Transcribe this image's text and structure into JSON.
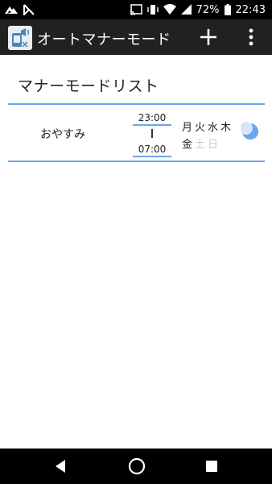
{
  "status_bar": {
    "battery_percent": "72%",
    "time": "22:43"
  },
  "app_bar": {
    "title": "オートマナーモード",
    "icons": [
      "app-logo-icon",
      "add-icon",
      "more-vert-icon"
    ]
  },
  "list": {
    "heading": "マナーモードリスト",
    "items": [
      {
        "name": "おやすみ",
        "start_time": "23:00",
        "separator": "|",
        "end_time": "07:00",
        "days_row1": [
          {
            "label": "月",
            "on": true
          },
          {
            "label": "火",
            "on": true
          },
          {
            "label": "水",
            "on": true
          },
          {
            "label": "木",
            "on": true
          }
        ],
        "days_row2": [
          {
            "label": "金",
            "on": true
          },
          {
            "label": "土",
            "on": false
          },
          {
            "label": "日",
            "on": false
          }
        ],
        "icon": "moon-icon"
      }
    ]
  },
  "colors": {
    "accent": "#6aa6ec",
    "app_bar": "#212121",
    "day_on": "#222222",
    "day_off": "#c9c9c9"
  },
  "nav_bar": {
    "icons": [
      "back-icon",
      "home-icon",
      "recents-icon"
    ]
  }
}
